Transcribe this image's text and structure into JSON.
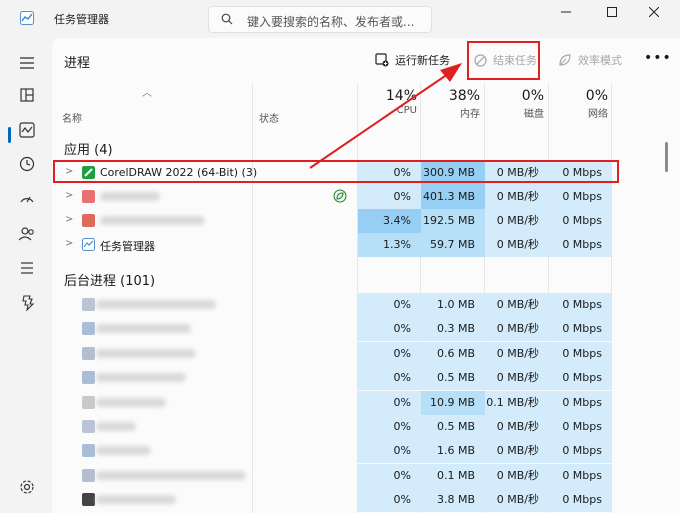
{
  "window": {
    "title": "任务管理器",
    "search_placeholder": "键入要搜索的名称、发布者或..."
  },
  "toolbar": {
    "page_title": "进程",
    "run_new_task": "运行新任务",
    "end_task": "结束任务",
    "efficiency_mode": "效率模式"
  },
  "columns": {
    "name": "名称",
    "status": "状态",
    "cpu": {
      "pct": "14%",
      "label": "CPU"
    },
    "memory": {
      "pct": "38%",
      "label": "内存"
    },
    "disk": {
      "pct": "0%",
      "label": "磁盘"
    },
    "network": {
      "pct": "0%",
      "label": "网络"
    }
  },
  "sections": {
    "apps": "应用 (4)",
    "background": "后台进程 (101)"
  },
  "apps": [
    {
      "name": "CorelDRAW 2022 (64-Bit) (3)",
      "cpu": "0%",
      "mem": "300.9 MB",
      "disk": "0 MB/秒",
      "net": "0 Mbps"
    },
    {
      "name": "",
      "cpu": "0%",
      "mem": "401.3 MB",
      "disk": "0 MB/秒",
      "net": "0 Mbps"
    },
    {
      "name": "",
      "cpu": "3.4%",
      "mem": "192.5 MB",
      "disk": "0 MB/秒",
      "net": "0 Mbps"
    },
    {
      "name": "任务管理器",
      "cpu": "1.3%",
      "mem": "59.7 MB",
      "disk": "0 MB/秒",
      "net": "0 Mbps"
    }
  ],
  "background": [
    {
      "cpu": "0%",
      "mem": "1.0 MB",
      "disk": "0 MB/秒",
      "net": "0 Mbps"
    },
    {
      "cpu": "0%",
      "mem": "0.3 MB",
      "disk": "0 MB/秒",
      "net": "0 Mbps"
    },
    {
      "cpu": "0%",
      "mem": "0.6 MB",
      "disk": "0 MB/秒",
      "net": "0 Mbps"
    },
    {
      "cpu": "0%",
      "mem": "0.5 MB",
      "disk": "0 MB/秒",
      "net": "0 Mbps"
    },
    {
      "cpu": "0%",
      "mem": "10.9 MB",
      "disk": "0.1 MB/秒",
      "net": "0 Mbps"
    },
    {
      "cpu": "0%",
      "mem": "0.5 MB",
      "disk": "0 MB/秒",
      "net": "0 Mbps"
    },
    {
      "cpu": "0%",
      "mem": "1.6 MB",
      "disk": "0 MB/秒",
      "net": "0 Mbps"
    },
    {
      "cpu": "0%",
      "mem": "0.1 MB",
      "disk": "0 MB/秒",
      "net": "0 Mbps"
    },
    {
      "cpu": "0%",
      "mem": "3.8 MB",
      "disk": "0 MB/秒",
      "net": "0 Mbps"
    }
  ],
  "colors": {
    "cell_light": "#d3ebfb",
    "cell_mid": "#b8dff8",
    "cell_strong": "#97cff4",
    "annotation_red": "#e02020",
    "accent": "#0067c0"
  }
}
